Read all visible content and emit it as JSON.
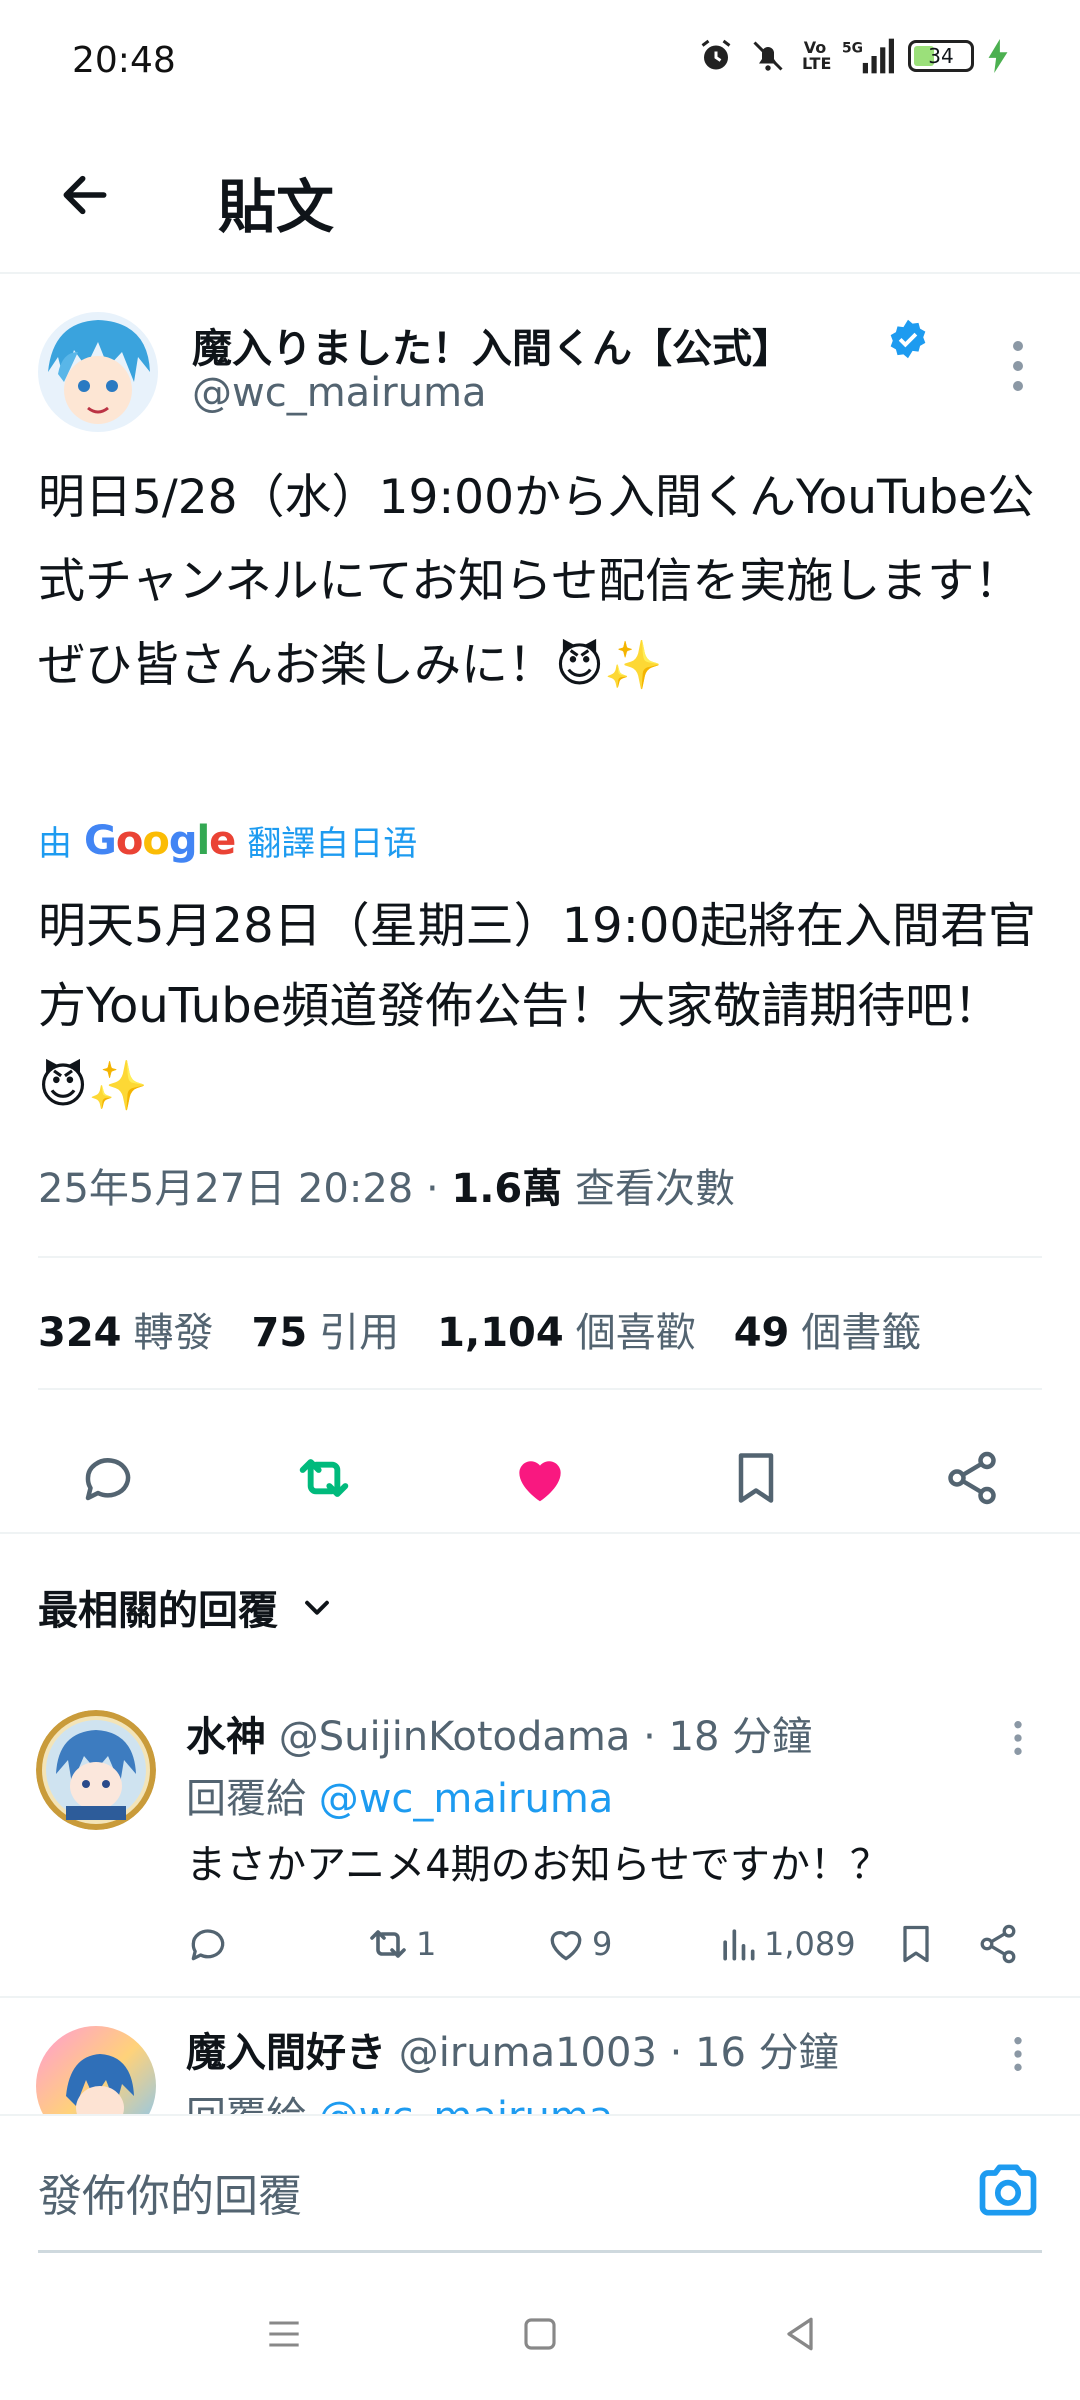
{
  "status_bar": {
    "time": "20:48",
    "network": "5G",
    "volte": "Vo LTE",
    "battery": "34"
  },
  "header": {
    "back_icon": "arrow-left-icon",
    "title": "貼文"
  },
  "post": {
    "author_name": "魔入りました！入間くん【公式】",
    "author_handle": "@wc_mairuma",
    "verified": true,
    "original_text": "明日5/28（水）19:00から入間くんYouTube公式チャンネルにてお知らせ配信を実施します！　ぜひ皆さんお楽しみに！😈✨",
    "translate_prefix": "由",
    "translate_brand": "Google",
    "translate_suffix": "翻譯自日语",
    "translated_text": "明天5月28日（星期三）19:00起將在入間君官方YouTube頻道發佈公告！大家敬請期待吧！ 😈✨",
    "date": "25年5月27日 20:28",
    "separator": "·",
    "views_count": "1.6萬",
    "views_label": "查看次數",
    "stats": [
      {
        "count": "324",
        "label": "轉發"
      },
      {
        "count": "75",
        "label": "引用"
      },
      {
        "count": "1,104",
        "label": "個喜歡"
      },
      {
        "count": "49",
        "label": "個書籤"
      }
    ],
    "liked": true,
    "colors": {
      "accent": "#1d9bf0",
      "like": "#f91880",
      "retweet": "#00ba7c"
    }
  },
  "sort": {
    "label": "最相關的回覆"
  },
  "replies": [
    {
      "name": "水神",
      "handle": "@SuijinKotodama",
      "time": "18 分鐘",
      "reply_prefix": "回覆給",
      "reply_to": "@wc_mairuma",
      "text": "まさかアニメ4期のお知らせですか！？",
      "retweets": "1",
      "likes": "9",
      "views": "1,089"
    },
    {
      "name": "魔入間好き",
      "handle": "@iruma1003",
      "time": "16 分鐘",
      "reply_prefix": "回覆給",
      "reply_to": "@wc_mairuma"
    }
  ],
  "compose": {
    "placeholder": "發佈你的回覆"
  }
}
